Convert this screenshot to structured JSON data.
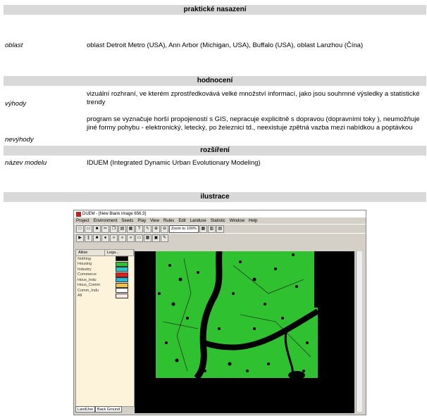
{
  "sections": {
    "practical": "praktické nasazení",
    "evaluation": "hodnocení",
    "extension": "rozšíření",
    "illustration": "ilustrace"
  },
  "area": {
    "label": "oblast",
    "value": "oblast Detroit Metro (USA), Ann Arbor (Michigan, USA), Buffalo (USA), oblast Lanzhou (Čína)"
  },
  "advantages": {
    "label": "výhody",
    "value": "vizuální rozhraní, ve kterém zprostředkovává velké množství informací, jako jsou souhrnné výsledky a statistické trendy"
  },
  "disadvantages": {
    "label": "nevýhody",
    "value": "program se vyznačuje horší propojeností s GIS, nepracuje explicitně s dopravou (dopravními toky ), neumožňuje jiné formy pohybu - elektronický, letecký, po železnici td., neexistuje zpětná vazba mezi nabídkou a poptávkou"
  },
  "model": {
    "label": "název modelu",
    "value": "IDUEM (Integrated Dynamic Urban Evolutionary Modeling)"
  },
  "screenshot": {
    "title": "DUEM - [New Blank Image  656.3]",
    "menu": [
      "Project",
      "Environment",
      "Seeds",
      "Play",
      "View",
      "Rules",
      "Edit",
      "Landuse",
      "Statistic",
      "Window",
      "Help"
    ],
    "zoom": "Zoom to 100%",
    "columns": [
      "Allow",
      "Lega..."
    ],
    "landuse": [
      {
        "name": "Nothing",
        "color": "#000000"
      },
      {
        "name": "Housing",
        "color": "#2fc12f"
      },
      {
        "name": "Industry",
        "color": "#29c8c8"
      },
      {
        "name": "Commerce",
        "color": "#e02020"
      },
      {
        "name": "Hous_Indu",
        "color": "#29b7d6"
      },
      {
        "name": "Hous_Comm",
        "color": "#f0c04a"
      },
      {
        "name": "Comm_Indu",
        "color": "#ffffff"
      },
      {
        "name": "All",
        "color": "#fde8e8"
      }
    ],
    "tabs": [
      "LandUse",
      "Back Ground"
    ],
    "green": "#2fc12f"
  }
}
